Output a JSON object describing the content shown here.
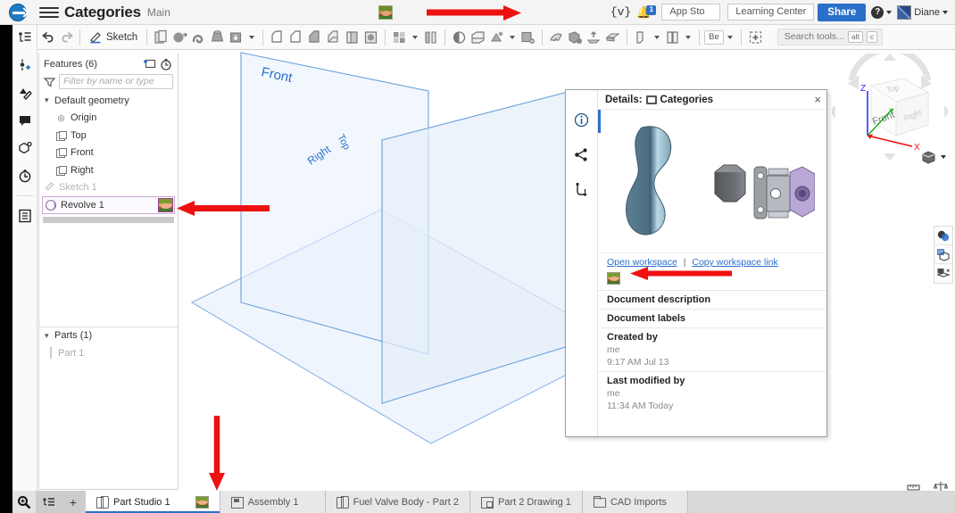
{
  "header": {
    "logo_icon": "onshape-logo-icon",
    "menu_icon": "hamburger-menu-icon",
    "document_title": "Categories",
    "workspace_name": "Main",
    "document_thumbnail_icon": "document-thumbnail-image",
    "feature_script_icon": "{v}",
    "notifications_icon": "bell-icon",
    "notifications_count": "1",
    "app_store_label": "App Sto",
    "learning_center_label": "Learning Center",
    "share_label": "Share",
    "help_icon": "?",
    "avatar_icon": "user-avatar",
    "user_name": "Diane"
  },
  "toolbar": {
    "undo_icon": "↶",
    "redo_icon": "↷",
    "sketch_label": "Sketch",
    "search_placeholder": "Search tools...",
    "search_kbd_alt": "alt",
    "search_kbd_key": "c",
    "tools": [
      {
        "name": "plane-tool"
      },
      {
        "name": "extrude-tool"
      },
      {
        "name": "revolve-tool"
      },
      {
        "name": "sweep-tool"
      },
      {
        "name": "loft-tool"
      },
      {
        "name": "hole-tool"
      },
      {
        "name": "fillet-tool"
      },
      {
        "name": "chamfer-tool"
      },
      {
        "name": "draft-tool"
      },
      {
        "name": "rib-tool"
      },
      {
        "name": "shell-tool"
      },
      {
        "name": "thicken-tool"
      },
      {
        "name": "pattern-tool"
      },
      {
        "name": "mirror-tool"
      },
      {
        "name": "boolean-tool"
      },
      {
        "name": "split-tool"
      },
      {
        "name": "transform-tool"
      },
      {
        "name": "delete-face-tool"
      },
      {
        "name": "move-face-tool"
      },
      {
        "name": "replace-face-tool"
      },
      {
        "name": "offset-surface-tool"
      },
      {
        "name": "enclose-tool"
      },
      {
        "name": "sheet-metal-tool"
      },
      {
        "name": "curve-tool"
      },
      {
        "name": "variable-tool"
      },
      {
        "name": "reference-tool"
      }
    ],
    "variable_label": "Be"
  },
  "left_rail": {
    "items": [
      {
        "name": "feature-list-icon",
        "glyph": "⊶"
      },
      {
        "name": "add-variable-icon",
        "glyph": "⋮"
      },
      {
        "name": "appearance-icon",
        "glyph": "◣"
      },
      {
        "name": "comments-icon",
        "glyph": "💬"
      },
      {
        "name": "part-properties-icon",
        "glyph": "⬡"
      },
      {
        "name": "history-icon",
        "glyph": "⏱"
      },
      {
        "name": "bill-of-materials-icon",
        "glyph": "▤"
      }
    ]
  },
  "feature_tree": {
    "title": "Features (6)",
    "add_folder_icon": "add-folder-icon",
    "rollback_icon": "history-clock-icon",
    "filter_icon": "filter-funnel-icon",
    "filter_placeholder": "Filter by name or type",
    "nodes": [
      {
        "label": "Default geometry",
        "icon": "chevron-down-icon",
        "type": "group"
      },
      {
        "label": "Origin",
        "icon": "origin-icon",
        "type": "child"
      },
      {
        "label": "Top",
        "icon": "plane-icon",
        "type": "child"
      },
      {
        "label": "Front",
        "icon": "plane-icon",
        "type": "child"
      },
      {
        "label": "Right",
        "icon": "plane-icon",
        "type": "child"
      }
    ],
    "sketch_label": "Sketch 1",
    "sketch_icon": "sketch-pencil-icon",
    "revolve_label": "Revolve 1",
    "revolve_icon": "revolve-feature-icon",
    "revolve_thumbnail_icon": "feature-thumbnail-image",
    "collapse_icon": "panel-collapse-icon",
    "parts_title": "Parts (1)",
    "parts_chevron": "chevron-down-icon",
    "part_label": "Part 1"
  },
  "canvas": {
    "planes": [
      {
        "name": "front-plane",
        "label": "Front"
      },
      {
        "name": "top-plane",
        "label": "Top"
      },
      {
        "name": "right-plane",
        "label": "Right"
      }
    ],
    "view_cube": {
      "name": "view-cube",
      "face_top": "Top",
      "face_front": "Front",
      "face_right": "Right",
      "axis_x": "X",
      "axis_y": "Y",
      "axis_z": "Z",
      "axis_x_color": "#e11",
      "axis_y_color": "#0a0",
      "axis_z_color": "#22f",
      "view_dropdown_icon": "view-orientation-icon"
    },
    "right_tools": [
      {
        "name": "display-state-icon"
      },
      {
        "name": "section-view-icon"
      },
      {
        "name": "render-view-icon"
      }
    ],
    "bottom_tools": [
      {
        "name": "measure-icon"
      },
      {
        "name": "mass-properties-icon"
      }
    ]
  },
  "details_panel": {
    "title_prefix": "Details:",
    "document_icon": "document-icon",
    "title": "Categories",
    "close_icon": "×",
    "rail": [
      {
        "name": "info-tab-icon",
        "glyph": "ⓘ"
      },
      {
        "name": "share-tab-icon",
        "glyph": "⋖"
      },
      {
        "name": "versions-tab-icon",
        "glyph": "⑂"
      }
    ],
    "preview_name": "document-preview-image",
    "open_workspace_label": "Open workspace",
    "link_separator": "|",
    "copy_workspace_link_label": "Copy workspace link",
    "thumbnail_icon": "document-thumbnail-image",
    "fields": [
      {
        "label": "Document description",
        "value": ""
      },
      {
        "label": "Document labels",
        "value": ""
      },
      {
        "label": "Created by",
        "value": "me",
        "date": "9:17 AM Jul 13"
      },
      {
        "label": "Last modified by",
        "value": "me",
        "date": "11:34 AM Today"
      }
    ]
  },
  "tab_bar": {
    "magnify_icon": "search-tabs-icon",
    "tab_list_icon": "tab-list-icon",
    "add_tab_icon": "+",
    "tabs": [
      {
        "label": "Part Studio 1",
        "icon": "part-studio-icon",
        "active": true,
        "thumbnail": true
      },
      {
        "label": "Assembly 1",
        "icon": "assembly-icon",
        "active": false,
        "thumbnail": false
      },
      {
        "label": "Fuel Valve Body - Part 2",
        "icon": "part-studio-icon",
        "active": false,
        "thumbnail": false
      },
      {
        "label": "Part 2 Drawing 1",
        "icon": "drawing-icon",
        "active": false,
        "thumbnail": false
      },
      {
        "label": "CAD Imports",
        "icon": "folder-icon",
        "active": false,
        "thumbnail": false
      }
    ]
  },
  "annotations": {
    "color": "#ee1111",
    "arrows": [
      {
        "name": "arrow-to-document-thumbnail",
        "direction": "right"
      },
      {
        "name": "arrow-to-revolve-thumbnail",
        "direction": "right"
      },
      {
        "name": "arrow-to-details-thumbnail",
        "direction": "right"
      },
      {
        "name": "arrow-to-tab-thumbnail",
        "direction": "down"
      }
    ]
  }
}
